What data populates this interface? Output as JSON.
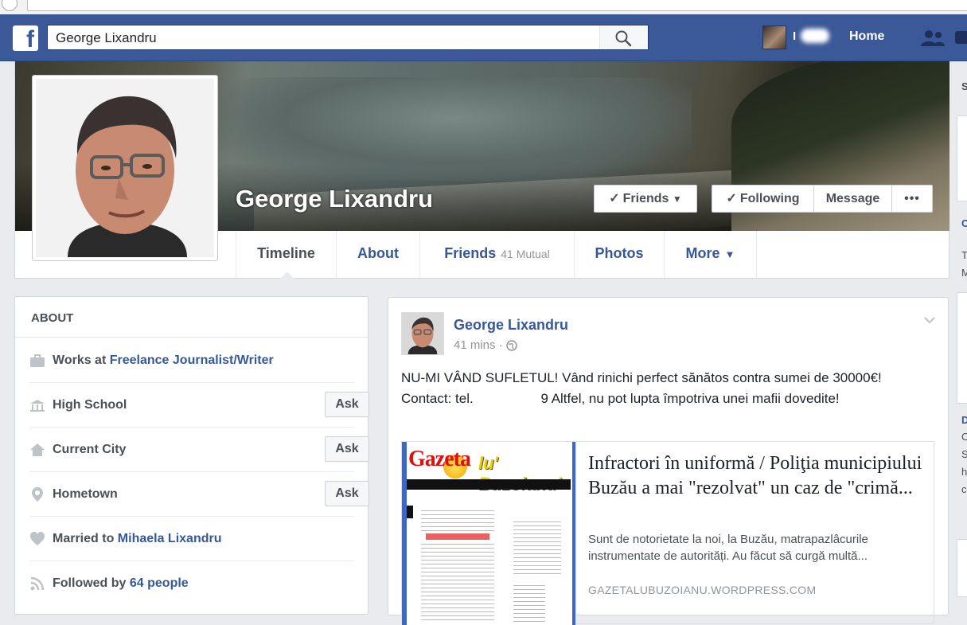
{
  "topbar": {
    "search_value": "George Lixandru",
    "home_label": "Home",
    "user_name_partial": "I"
  },
  "profile": {
    "name": "George Lixandru",
    "buttons": {
      "friends": "Friends",
      "following": "Following",
      "message": "Message",
      "more": "•••"
    },
    "tabs": {
      "timeline": "Timeline",
      "about": "About",
      "friends": "Friends",
      "friends_mutual": "41 Mutual",
      "photos": "Photos",
      "more": "More"
    }
  },
  "about": {
    "title": "ABOUT",
    "rows": [
      {
        "prefix": "Works at ",
        "link": "Freelance Journalist/Writer",
        "icon": "briefcase-icon"
      },
      {
        "prefix": "High School",
        "link": "",
        "ask": "Ask",
        "icon": "school-icon"
      },
      {
        "prefix": "Current City",
        "link": "",
        "ask": "Ask",
        "icon": "house-icon"
      },
      {
        "prefix": "Hometown",
        "link": "",
        "ask": "Ask",
        "icon": "map-pin-icon"
      },
      {
        "prefix": "Married to ",
        "link": "Mihaela Lixandru",
        "icon": "heart-icon"
      },
      {
        "prefix": "Followed by ",
        "link": "64 people",
        "icon": "rss-icon"
      }
    ]
  },
  "post": {
    "author": "George Lixandru",
    "time": "41 mins",
    "separator": "·",
    "text_part1": "NU-MI VÂND SUFLETUL! Vând rinichi perfect sănătos contra sumei de 30000€! Contact: tel.",
    "text_part2": "9 Altfel, nu pot lupta împotriva unei mafii dovedite!",
    "link": {
      "title": "Infractori în uniformă / Poliţia municipiului Buzău a mai \"rezolvat\" un caz de \"crimă...",
      "description": "Sunt de notorietate la noi, la Buzău, matrapazlâcurile instrumentate de autorități. Au făcut să curgă multă...",
      "domain": "GAZETALUBUZOIANU.WORDPRESS.COM",
      "thumb_logo_a": "Gazeta",
      "thumb_logo_b": "lu' Buzoianu'"
    }
  },
  "right_sidebar": {
    "chars": [
      "S",
      "C",
      "T",
      "M",
      "D",
      "C",
      "S",
      "h",
      "c"
    ]
  },
  "colors": {
    "brand": "#3b5998",
    "link": "#365899",
    "muted": "#90949c"
  }
}
